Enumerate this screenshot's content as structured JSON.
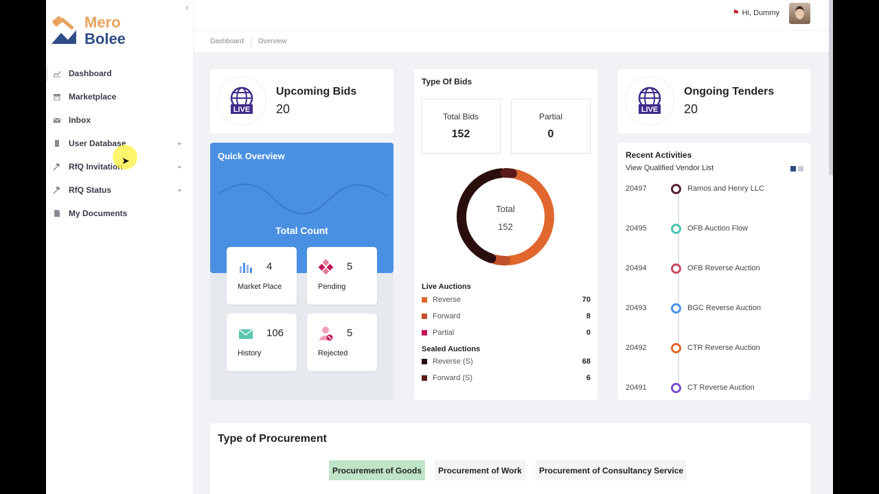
{
  "brand": {
    "line1": "Mero",
    "line2": "Bolee"
  },
  "sidebar": {
    "items": [
      {
        "label": "Dashboard",
        "icon": "chart-line-icon",
        "expandable": false
      },
      {
        "label": "Marketplace",
        "icon": "store-icon",
        "expandable": false
      },
      {
        "label": "Inbox",
        "icon": "mail-icon",
        "expandable": false
      },
      {
        "label": "User Database",
        "icon": "building-icon",
        "expandable": true
      },
      {
        "label": "RfQ Invitation",
        "icon": "gavel-icon",
        "expandable": true
      },
      {
        "label": "RfQ Status",
        "icon": "gavel-icon",
        "expandable": true
      },
      {
        "label": "My Documents",
        "icon": "document-icon",
        "expandable": false
      }
    ]
  },
  "header": {
    "greeting": "Hi, Dummy"
  },
  "breadcrumb": [
    "Dashboard",
    "Overview"
  ],
  "upcoming": {
    "title": "Upcoming Bids",
    "value": "20",
    "badge": "LIVE"
  },
  "ongoing": {
    "title": "Ongoing Tenders",
    "value": "20",
    "badge": "LIVE"
  },
  "quick_overview": {
    "title": "Quick Overview",
    "subtitle": "Total Count",
    "items": [
      {
        "label": "Market Place",
        "value": "4",
        "icon": "bar-chart-icon"
      },
      {
        "label": "Pending",
        "value": "5",
        "icon": "diamond-icon"
      },
      {
        "label": "History",
        "value": "106",
        "icon": "envelope-icon"
      },
      {
        "label": "Rejected",
        "value": "5",
        "icon": "user-rejected-icon"
      }
    ]
  },
  "type_of_bids": {
    "title": "Type Of Bids",
    "total_label": "Total Bids",
    "total_value": "152",
    "partial_label": "Partial",
    "partial_value": "0",
    "donut_label": "Total",
    "donut_value": "152",
    "live_heading": "Live Auctions",
    "live": [
      {
        "label": "Reverse",
        "value": "70",
        "color": "#e0672d"
      },
      {
        "label": "Forward",
        "value": "8",
        "color": "#c0512a"
      },
      {
        "label": "Partial",
        "value": "0",
        "color": "#c2185b"
      }
    ],
    "sealed_heading": "Sealed Auctions",
    "sealed": [
      {
        "label": "Reverse (S)",
        "value": "68",
        "color": "#2a0d0d"
      },
      {
        "label": "Forward (S)",
        "value": "6",
        "color": "#5a1a1a"
      }
    ]
  },
  "recent": {
    "title": "Recent Activities",
    "subtitle": "View Qualified Vendor List",
    "items": [
      {
        "id": "20497",
        "name": "Ramos and Henry LLC",
        "color": "#5a2235"
      },
      {
        "id": "20495",
        "name": "OFB Auction Flow",
        "color": "#4fc3b3"
      },
      {
        "id": "20494",
        "name": "OFB Reverse Auction",
        "color": "#c74b63"
      },
      {
        "id": "20493",
        "name": "BGC Reverse Auction",
        "color": "#4a90e2"
      },
      {
        "id": "20492",
        "name": "CTR Reverse Auction",
        "color": "#e0672d"
      },
      {
        "id": "20491",
        "name": "CT Reverse Auction",
        "color": "#7b4fc9"
      }
    ]
  },
  "procurement": {
    "title": "Type of Procurement",
    "tabs": [
      "Procurement of Goods",
      "Procurement of Work",
      "Procurement of Consultancy Service"
    ]
  }
}
